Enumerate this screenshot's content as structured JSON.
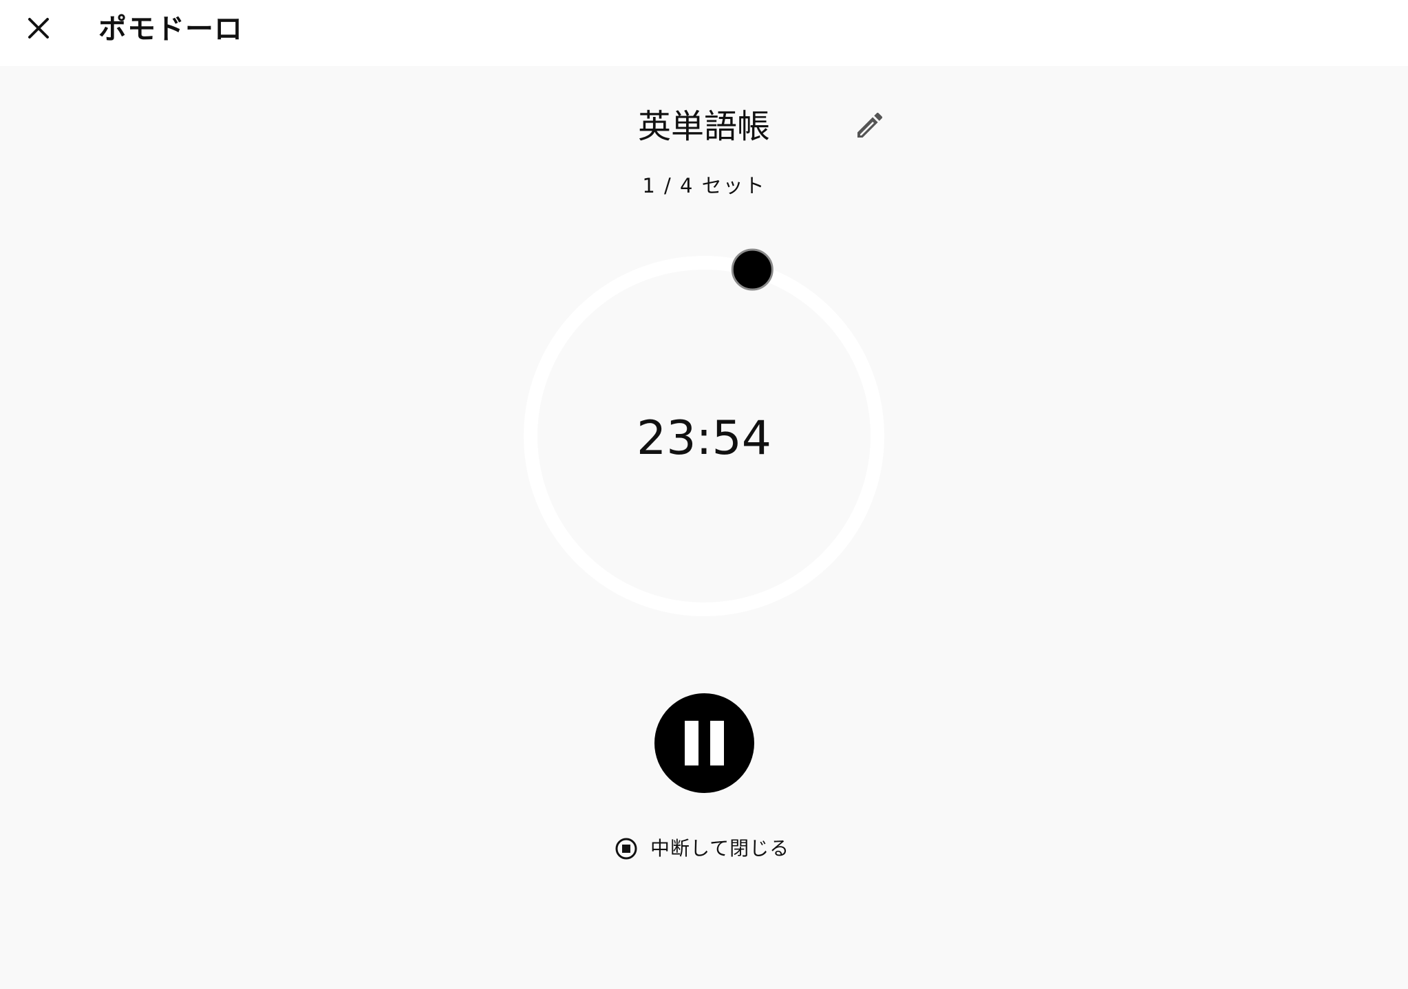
{
  "header": {
    "title": "ポモドーロ"
  },
  "task": {
    "title": "英単語帳"
  },
  "session": {
    "set_label": "1 / 4 セット"
  },
  "timer": {
    "remaining": "23:54",
    "progress_fraction": 0.045
  },
  "controls": {
    "stop_label": "中断して閉じる"
  },
  "icons": {
    "close": "close-icon",
    "edit": "pencil-icon",
    "pause": "pause-icon",
    "stop": "stop-circle-icon"
  },
  "colors": {
    "background": "#f9f9f9",
    "topbar": "#ffffff",
    "ring_track": "#ffffff",
    "knob": "#000000",
    "knob_border": "#8a8a8a",
    "pause_button": "#000000"
  }
}
